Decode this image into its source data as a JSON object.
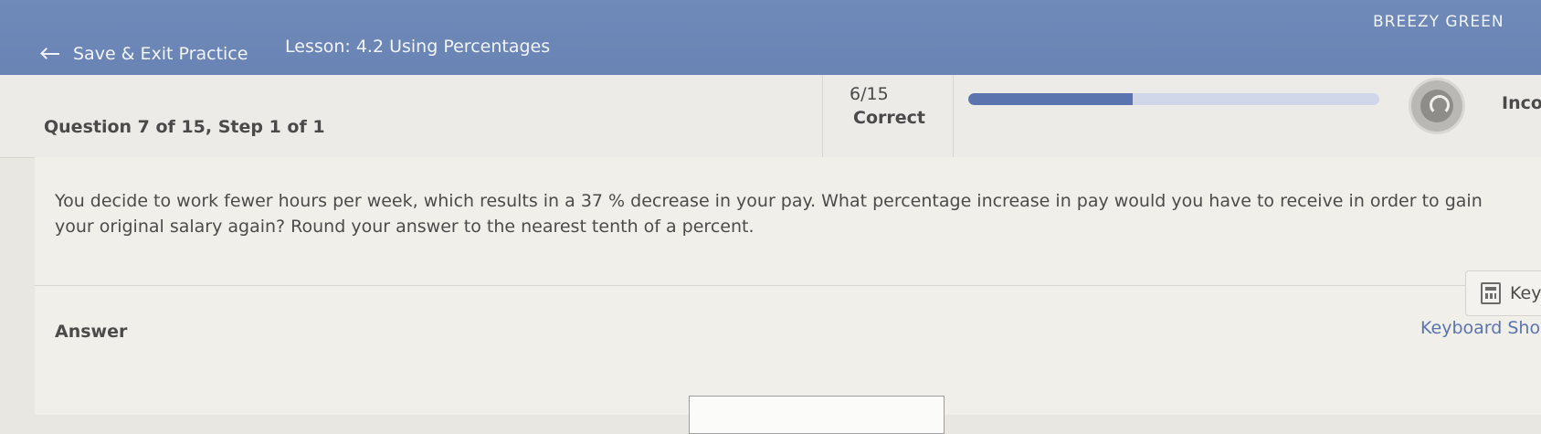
{
  "header": {
    "back_label": "Save & Exit Practice",
    "lesson": "Lesson: 4.2 Using Percentages",
    "user_name": "BREEZY GREEN"
  },
  "status": {
    "question_label": "Question 7 of 15, Step 1 of 1",
    "score": "6/15",
    "score_label": "Correct",
    "progress_fraction": 0.4,
    "incomplete_label": "Inco"
  },
  "question": {
    "line1": "You decide to work fewer hours per week, which results in a 37 %  decrease in your pay. What percentage increase in pay would you have to receive in order to gain",
    "line2": "your original salary again? Round your answer to the nearest tenth of a percent."
  },
  "answer": {
    "label": "Answer",
    "keypad_label": "Key",
    "shortcuts_label": "Keyboard Sho"
  },
  "colors": {
    "header_bg": "#6f89b9",
    "accent": "#5a74b0"
  },
  "icons": [
    "back-arrow-icon",
    "gauge-icon",
    "calculator-icon"
  ]
}
